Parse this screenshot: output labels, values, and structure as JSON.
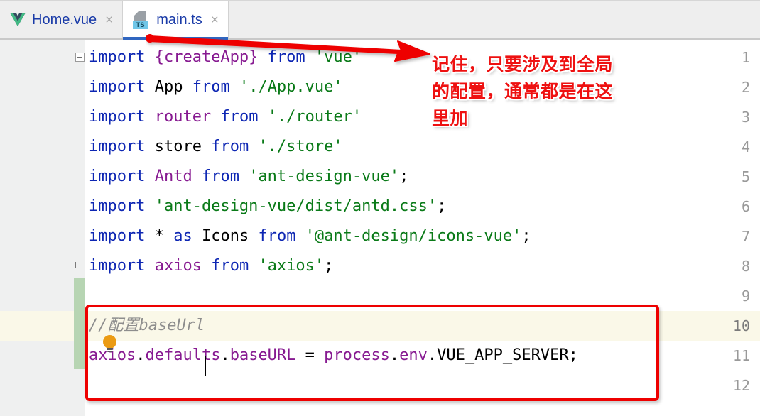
{
  "window": {
    "app": "IDE code editor"
  },
  "tabs": [
    {
      "label": "Home.vue",
      "icon": "vue-icon",
      "active": false,
      "close": "×"
    },
    {
      "label": "main.ts",
      "icon": "typescript-file-icon",
      "badge": "TS",
      "active": true,
      "close": "×"
    }
  ],
  "editor": {
    "line_numbers": [
      "1",
      "2",
      "3",
      "4",
      "5",
      "6",
      "7",
      "8",
      "9",
      "10",
      "11",
      "12"
    ],
    "current_line": "10",
    "caret_line": "10",
    "lines": [
      {
        "n": "1",
        "segments": [
          {
            "t": "import ",
            "c": "kw"
          },
          {
            "t": "{createApp}",
            "c": "pur"
          },
          {
            "t": " ",
            "c": "op"
          },
          {
            "t": "from ",
            "c": "kw"
          },
          {
            "t": "'vue'",
            "c": "str"
          }
        ]
      },
      {
        "n": "2",
        "segments": [
          {
            "t": "import ",
            "c": "kw"
          },
          {
            "t": "App",
            "c": "id"
          },
          {
            "t": " ",
            "c": "op"
          },
          {
            "t": "from ",
            "c": "kw"
          },
          {
            "t": "'./App.vue'",
            "c": "str"
          }
        ]
      },
      {
        "n": "3",
        "segments": [
          {
            "t": "import ",
            "c": "kw"
          },
          {
            "t": "router",
            "c": "pur"
          },
          {
            "t": " ",
            "c": "op"
          },
          {
            "t": "from ",
            "c": "kw"
          },
          {
            "t": "'./router'",
            "c": "str"
          }
        ]
      },
      {
        "n": "4",
        "segments": [
          {
            "t": "import ",
            "c": "kw"
          },
          {
            "t": "store",
            "c": "id"
          },
          {
            "t": " ",
            "c": "op"
          },
          {
            "t": "from ",
            "c": "kw"
          },
          {
            "t": "'./store'",
            "c": "str"
          }
        ]
      },
      {
        "n": "5",
        "segments": [
          {
            "t": "import ",
            "c": "kw"
          },
          {
            "t": "Antd",
            "c": "pur"
          },
          {
            "t": " ",
            "c": "op"
          },
          {
            "t": "from ",
            "c": "kw"
          },
          {
            "t": "'ant-design-vue'",
            "c": "str"
          },
          {
            "t": ";",
            "c": "op"
          }
        ]
      },
      {
        "n": "6",
        "segments": [
          {
            "t": "import ",
            "c": "kw"
          },
          {
            "t": "'ant-design-vue/dist/antd.css'",
            "c": "str"
          },
          {
            "t": ";",
            "c": "op"
          }
        ]
      },
      {
        "n": "7",
        "segments": [
          {
            "t": "import ",
            "c": "kw"
          },
          {
            "t": "*",
            "c": "op"
          },
          {
            "t": " ",
            "c": "op"
          },
          {
            "t": "as ",
            "c": "kw"
          },
          {
            "t": "Icons",
            "c": "id"
          },
          {
            "t": " ",
            "c": "op"
          },
          {
            "t": "from ",
            "c": "kw"
          },
          {
            "t": "'@ant-design/icons-vue'",
            "c": "str"
          },
          {
            "t": ";",
            "c": "op"
          }
        ]
      },
      {
        "n": "8",
        "segments": [
          {
            "t": "import ",
            "c": "kw"
          },
          {
            "t": "axios",
            "c": "pur"
          },
          {
            "t": " ",
            "c": "op"
          },
          {
            "t": "from ",
            "c": "kw"
          },
          {
            "t": "'axios'",
            "c": "str"
          },
          {
            "t": ";",
            "c": "op"
          }
        ]
      },
      {
        "n": "9",
        "segments": []
      },
      {
        "n": "10",
        "segments": [
          {
            "t": "//配置baseUrl",
            "c": "cmt"
          }
        ]
      },
      {
        "n": "11",
        "segments": [
          {
            "t": "axios",
            "c": "pur"
          },
          {
            "t": ".",
            "c": "op"
          },
          {
            "t": "defaults",
            "c": "pur"
          },
          {
            "t": ".",
            "c": "op"
          },
          {
            "t": "baseURL",
            "c": "pur"
          },
          {
            "t": " = ",
            "c": "op"
          },
          {
            "t": "process",
            "c": "pur"
          },
          {
            "t": ".",
            "c": "op"
          },
          {
            "t": "env",
            "c": "pur"
          },
          {
            "t": ".",
            "c": "op"
          },
          {
            "t": "VUE_APP_SERVER",
            "c": "id"
          },
          {
            "t": ";",
            "c": "op"
          }
        ]
      },
      {
        "n": "12",
        "segments": []
      }
    ]
  },
  "gutter": {
    "lightbulb": "intention-lightbulb",
    "fold_marker_top": "fold-collapse-marker",
    "fold_marker_end": "fold-region-end-marker",
    "vcs_change_marker": "modified-lines-marker"
  },
  "annotations": {
    "note_text": "记住，只要涉及到全局\n的配置，通常都是在这\n里加",
    "note_color": "#ee1111",
    "arrow_color": "#ee0000",
    "box_color": "#ee0000"
  },
  "colors": {
    "keyword": "#0d26b3",
    "identifier": "#000000",
    "symbol_purple": "#871a91",
    "string_green": "#0a7a18",
    "comment_gray": "#8d8d8d",
    "tab_active_underline": "#3066c0",
    "current_line_bg": "#faf8e8",
    "gutter_bg": "#eff0f0",
    "vcs_green": "#b7d5b3"
  }
}
